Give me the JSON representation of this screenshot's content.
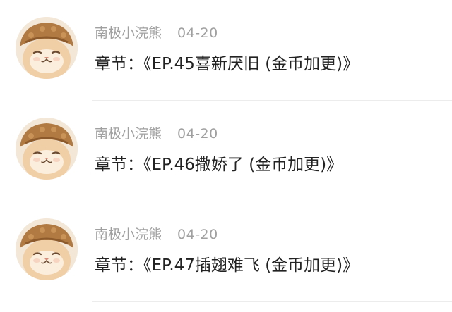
{
  "comments": [
    {
      "author": "南极小浣熊",
      "date": "04-20",
      "chapter_label": "章节：",
      "chapter_title": "《EP.45喜新厌旧 (金币加更)》",
      "avatar_icon": "cat-in-hat-avatar"
    },
    {
      "author": "南极小浣熊",
      "date": "04-20",
      "chapter_label": "章节：",
      "chapter_title": "《EP.46撒娇了 (金币加更)》",
      "avatar_icon": "cat-in-hat-avatar"
    },
    {
      "author": "南极小浣熊",
      "date": "04-20",
      "chapter_label": "章节：",
      "chapter_title": "《EP.47插翅难飞 (金币加更)》",
      "avatar_icon": "cat-in-hat-avatar"
    }
  ],
  "colors": {
    "author_text": "#a0a0a0",
    "chapter_text": "#222222",
    "divider": "#ececec",
    "background": "#ffffff"
  }
}
